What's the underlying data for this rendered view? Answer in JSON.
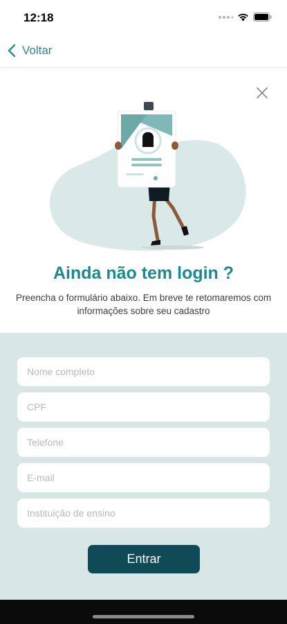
{
  "status": {
    "time": "12:18"
  },
  "nav": {
    "back_label": "Voltar"
  },
  "hero": {
    "title": "Ainda não tem login ?",
    "subtitle": "Preencha o formulário abaixo. Em breve te retomaremos com informações sobre seu cadastro"
  },
  "form": {
    "fields": [
      {
        "placeholder": "Nome completo",
        "value": ""
      },
      {
        "placeholder": "CPF",
        "value": ""
      },
      {
        "placeholder": "Telefone",
        "value": ""
      },
      {
        "placeholder": "E-mail",
        "value": ""
      },
      {
        "placeholder": "Instituição de ensino",
        "value": ""
      }
    ],
    "submit_label": "Entrar"
  },
  "icons": {
    "back": "chevron-left-icon",
    "close": "close-icon",
    "wifi": "wifi-icon",
    "battery": "battery-icon"
  },
  "colors": {
    "accent": "#1b8a8e",
    "form_background": "#d9e6e6",
    "button": "#0f4a56",
    "blob": "#dbe8e8"
  }
}
